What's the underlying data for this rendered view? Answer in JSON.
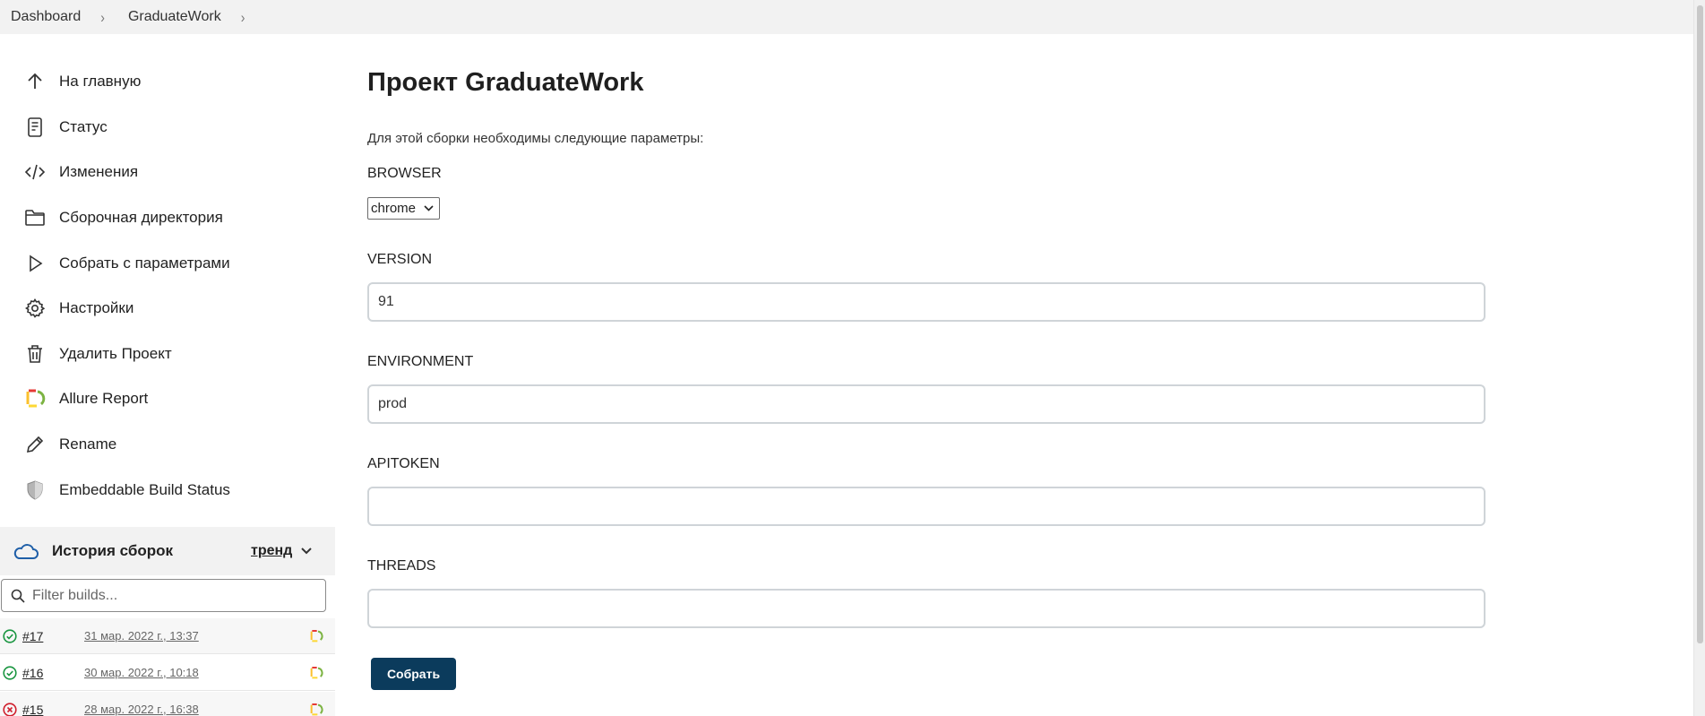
{
  "breadcrumb": {
    "items": [
      "Dashboard",
      "GraduateWork"
    ],
    "separator": "›"
  },
  "sidebar": {
    "items": [
      {
        "label": "На главную",
        "icon": "arrow-up-icon"
      },
      {
        "label": "Статус",
        "icon": "document-icon"
      },
      {
        "label": "Изменения",
        "icon": "code-icon"
      },
      {
        "label": "Сборочная директория",
        "icon": "folder-icon"
      },
      {
        "label": "Собрать с параметрами",
        "icon": "play-icon"
      },
      {
        "label": "Настройки",
        "icon": "gear-icon"
      },
      {
        "label": "Удалить Проект",
        "icon": "trash-icon"
      },
      {
        "label": "Allure Report",
        "icon": "allure-icon"
      },
      {
        "label": "Rename",
        "icon": "pencil-icon"
      },
      {
        "label": "Embeddable Build Status",
        "icon": "shield-icon"
      }
    ]
  },
  "history": {
    "title": "История сборок",
    "trend_label": "тренд",
    "filter_placeholder": "Filter builds...",
    "builds": [
      {
        "number": "#17",
        "date": "31 мар. 2022 г., 13:37",
        "status": "success"
      },
      {
        "number": "#16",
        "date": "30 мар. 2022 г., 10:18",
        "status": "success"
      },
      {
        "number": "#15",
        "date": "28 мар. 2022 г., 16:38",
        "status": "failed"
      }
    ]
  },
  "main": {
    "title": "Проект GraduateWork",
    "description": "Для этой сборки необходимы следующие параметры:",
    "params": {
      "browser": {
        "label": "BROWSER",
        "value": "chrome"
      },
      "version": {
        "label": "VERSION",
        "value": "91"
      },
      "environment": {
        "label": "ENVIRONMENT",
        "value": "prod"
      },
      "apitoken": {
        "label": "APITOKEN",
        "value": ""
      },
      "threads": {
        "label": "THREADS",
        "value": ""
      }
    },
    "submit_label": "Собрать"
  },
  "colors": {
    "primary_button": "#0b3b5c",
    "success": "#1a9641",
    "failure": "#d0202e",
    "cloud": "#1f5fa8"
  }
}
